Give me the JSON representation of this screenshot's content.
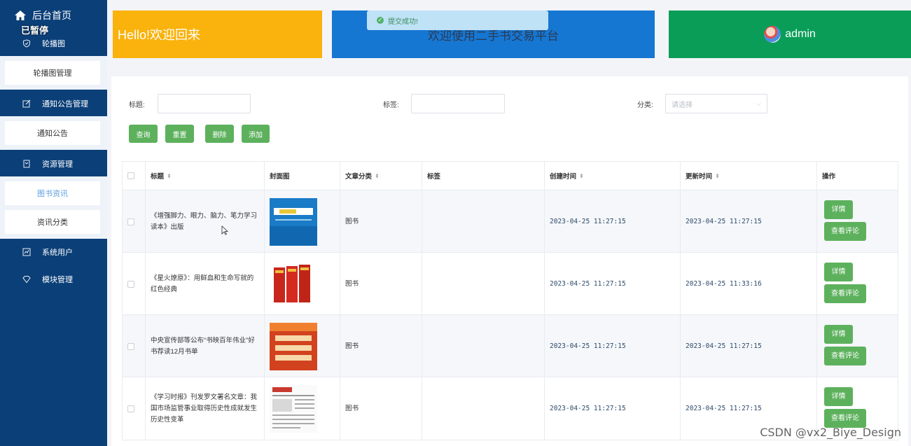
{
  "sidebar": {
    "home_label": "后台首页",
    "overlay_text": "已暂停",
    "groups": [
      {
        "label": "轮播图",
        "icon": "shield-icon"
      },
      {
        "label": "通知公告管理",
        "icon": "edit-icon"
      },
      {
        "label": "资源管理",
        "icon": "book-icon"
      },
      {
        "label": "系统用户",
        "icon": "chart-icon"
      },
      {
        "label": "模块管理",
        "icon": "diamond-icon"
      }
    ],
    "subs": [
      {
        "label": "轮播图管理"
      },
      {
        "label": "通知公告"
      },
      {
        "label": "图书资讯"
      },
      {
        "label": "资讯分类"
      }
    ]
  },
  "header": {
    "hello": "Hello!欢迎回来",
    "welcome": "欢迎使用二手书交易平台",
    "admin": "admin"
  },
  "toast": {
    "message": "提交成功!"
  },
  "filters": {
    "title_label": "标题:",
    "tag_label": "标签:",
    "category_label": "分类:",
    "category_placeholder": "请选择"
  },
  "buttons": {
    "query": "查询",
    "reset": "重置",
    "delete": "删除",
    "add": "添加"
  },
  "table": {
    "headers": [
      "标题",
      "封面图",
      "文章分类",
      "标签",
      "创建时间",
      "更新时间",
      "操作"
    ],
    "rows": [
      {
        "title": "《增强脚力、眼力、脑力、笔力学习读本》出版",
        "category": "图书",
        "tag": "",
        "created": "2023-04-25 11:27:15",
        "updated": "2023-04-25 11:27:15"
      },
      {
        "title": "《星火燎原》：用鲜血和生命写就的红色经典",
        "category": "图书",
        "tag": "",
        "created": "2023-04-25 11:27:15",
        "updated": "2023-04-25 11:33:16"
      },
      {
        "title": "中央宣传部等公布“书映百年伟业”好书荐读12月书单",
        "category": "图书",
        "tag": "",
        "created": "2023-04-25 11:27:15",
        "updated": "2023-04-25 11:27:15"
      },
      {
        "title": "《学习时报》刊发罗文署名文章：我国市场监管事业取得历史性成就发生历史性变革",
        "category": "图书",
        "tag": "",
        "created": "2023-04-25 11:27:15",
        "updated": "2023-04-25 11:27:15"
      }
    ],
    "op_detail": "详情",
    "op_comment": "查看评论"
  },
  "watermark": "CSDN @vx2_Biye_Design",
  "colors": {
    "sidebar": "#0b3f78",
    "hello": "#fab20c",
    "welcome": "#1677d2",
    "admin": "#0a9d58",
    "button": "#5db15d"
  }
}
